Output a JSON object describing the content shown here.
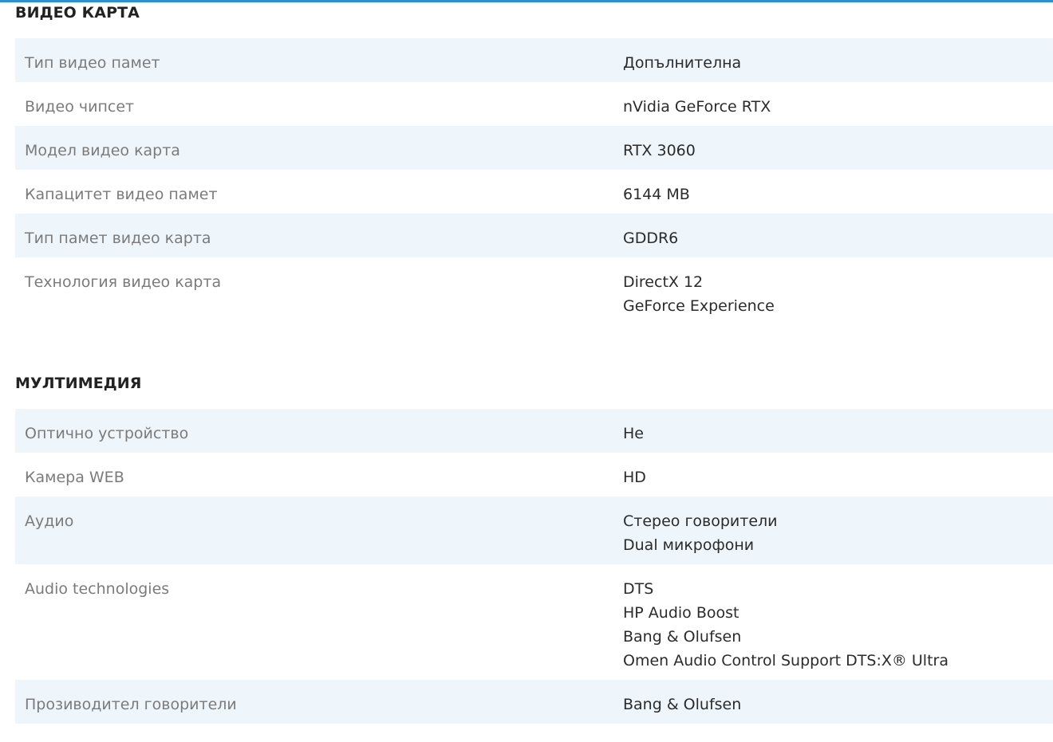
{
  "sections": [
    {
      "title": "ВИДЕО КАРТА",
      "rows": [
        {
          "label": "Тип видео памет",
          "values": [
            "Допълнителна"
          ]
        },
        {
          "label": "Видео чипсет",
          "values": [
            "nVidia GeForce RTX"
          ]
        },
        {
          "label": "Модел видео карта",
          "values": [
            "RTX 3060"
          ]
        },
        {
          "label": "Капацитет видео памет",
          "values": [
            "6144 MB"
          ]
        },
        {
          "label": "Тип памет видео карта",
          "values": [
            "GDDR6"
          ]
        },
        {
          "label": "Технология видео карта",
          "values": [
            "DirectX 12",
            "GeForce Experience"
          ]
        }
      ]
    },
    {
      "title": "МУЛТИМЕДИЯ",
      "rows": [
        {
          "label": "Оптично устройство",
          "values": [
            "Не"
          ]
        },
        {
          "label": "Камера WEB",
          "values": [
            "HD"
          ]
        },
        {
          "label": "Аудио",
          "values": [
            "Стерео говорители",
            "Dual микрофони"
          ]
        },
        {
          "label": "Audio technologies",
          "values": [
            "DTS",
            "HP Audio Boost",
            "Bang & Olufsen",
            "Omen Audio Control Support DTS:X® Ultra"
          ]
        },
        {
          "label": "Прозиводител говорители",
          "values": [
            "Bang & Olufsen"
          ]
        }
      ]
    }
  ],
  "colors": {
    "accent_line": "#2e8fd6",
    "row_shade": "#eef5fb",
    "label_text": "#7b7b7b",
    "value_text": "#2b2b2b",
    "heading_text": "#222222"
  }
}
